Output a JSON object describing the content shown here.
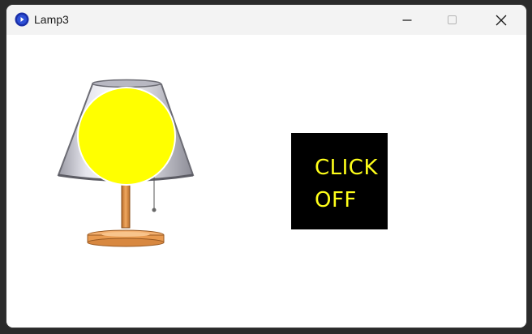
{
  "window": {
    "title": "Lamp3",
    "app_icon": "app-logo-icon",
    "controls": {
      "minimize_icon": "minimize-icon",
      "maximize_icon": "maximize-icon",
      "close_icon": "close-icon"
    }
  },
  "lamp": {
    "state": "on",
    "bulb_color": "#ffff00",
    "shade_color": "#c8c8d0",
    "base_color": "#e89a50"
  },
  "switch": {
    "line1": "CLICK",
    "line2": "OFF",
    "background": "#000000",
    "text_color": "#ffff1a"
  }
}
